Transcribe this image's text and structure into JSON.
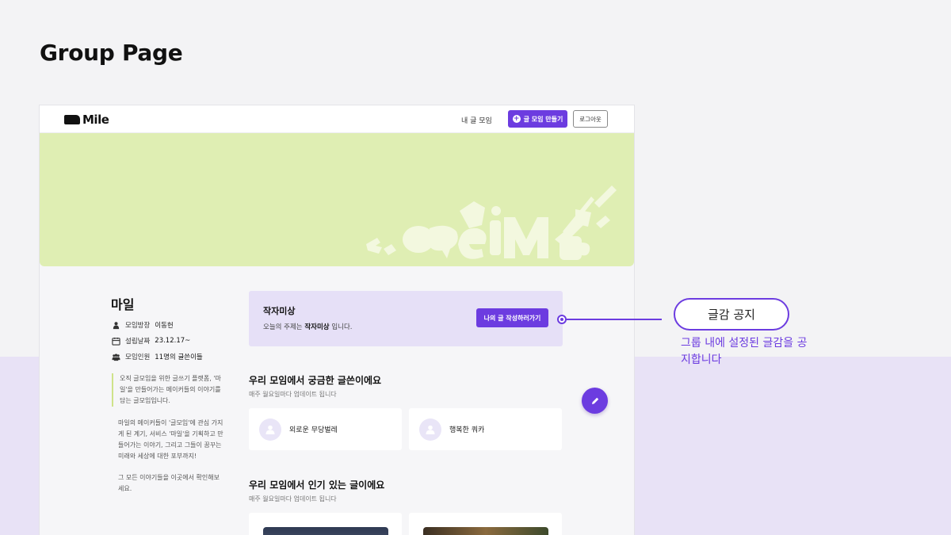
{
  "slide": {
    "title": "Group Page"
  },
  "nav": {
    "logo": "Mile",
    "my_groups": "내 글 모임",
    "create_group": "글 모임 만들기",
    "logout": "로그아웃"
  },
  "group": {
    "name": "마일",
    "meta": [
      {
        "icon": "person-icon",
        "label": "모임방장",
        "value": "이동헌"
      },
      {
        "icon": "calendar-icon",
        "label": "설립날짜",
        "value": "23.12.17~"
      },
      {
        "icon": "people-icon",
        "label": "모임인원",
        "value": "11명의 글쓴이들"
      }
    ],
    "description_lines": [
      "오직 글모임을 위한 글쓰기 플랫폼, '마일'을 만들어가는 메이커들의 이야기를 담는 글모임입니다.",
      "마일의 메이커들이 '글모임'에 관심 가지게 된 계기, 서비스 '마일'을 기획하고 만들어가는 이야기, 그리고 그들이 꿈꾸는 미래와 세상에 대한 포부까지!",
      "그 모든 이야기들을 이곳에서 확인해보세요."
    ]
  },
  "notice": {
    "title": "작자미상",
    "sub_prefix": "오늘의 주제는",
    "sub_topic": "작자미상",
    "sub_suffix": "입니다.",
    "button": "나의 글 작성하러가기"
  },
  "curious": {
    "title": "우리 모임에서 궁금한 글쓴이에요",
    "subtitle": "매주 월요일마다 업데이트 됩니다",
    "writers": [
      "외로운 무당벌레",
      "행복한 쿼카"
    ]
  },
  "popular": {
    "title": "우리 모임에서 인기 있는 글이에요",
    "subtitle": "매주 월요일마다 업데이트 됩니다"
  },
  "annotation": {
    "label": "글감 공지",
    "description": "그룹 내에 설정된 글감을 공지합니다"
  },
  "colors": {
    "accent": "#6c3ce0",
    "banner": "#dfeeb3",
    "notice_bg": "#e6e0f7",
    "band": "#e8e2f6"
  }
}
